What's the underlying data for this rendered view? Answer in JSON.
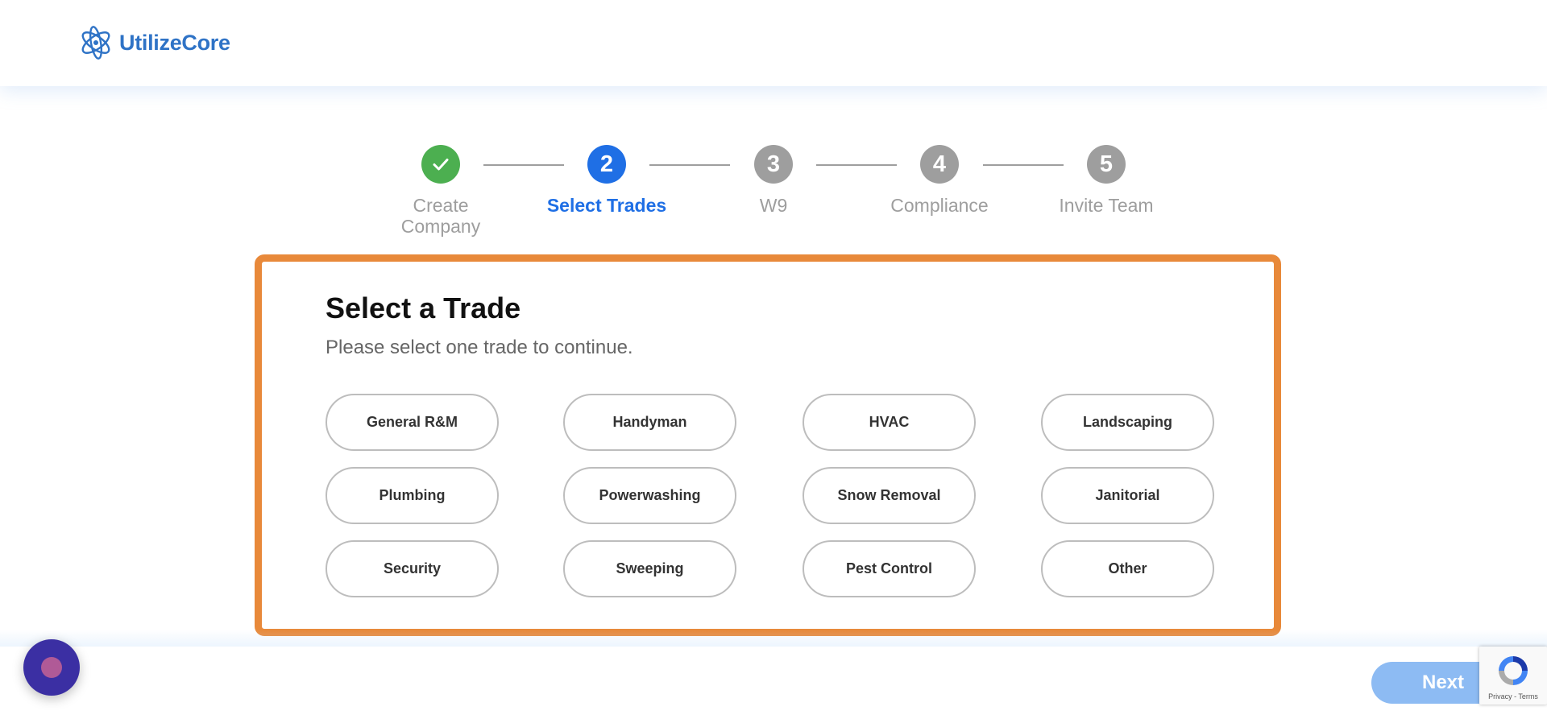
{
  "header": {
    "logo_text": "UtilizeCore"
  },
  "stepper": {
    "steps": [
      {
        "number": "1",
        "label_line1": "Create",
        "label_line2": "Company",
        "state": "completed"
      },
      {
        "number": "2",
        "label_line1": "Select Trades",
        "label_line2": "",
        "state": "active"
      },
      {
        "number": "3",
        "label_line1": "W9",
        "label_line2": "",
        "state": "pending"
      },
      {
        "number": "4",
        "label_line1": "Compliance",
        "label_line2": "",
        "state": "pending"
      },
      {
        "number": "5",
        "label_line1": "Invite Team",
        "label_line2": "",
        "state": "pending"
      }
    ]
  },
  "main": {
    "title": "Select a Trade",
    "subtitle": "Please select one trade to continue.",
    "trades": [
      "General R&M",
      "Handyman",
      "HVAC",
      "Landscaping",
      "Plumbing",
      "Powerwashing",
      "Snow Removal",
      "Janitorial",
      "Security",
      "Sweeping",
      "Pest Control",
      "Other"
    ]
  },
  "footer": {
    "next_label": "Next",
    "recaptcha_links": "Privacy - Terms"
  },
  "colors": {
    "brand": "#2f73c6",
    "active_step": "#1f6fe5",
    "completed_step": "#4caf50",
    "pending_step": "#9e9e9e",
    "card_border": "#e8893a",
    "next_button": "#8dbbf3",
    "chat_bubble": "#3b2fa3"
  },
  "icons": {
    "logo": "atom-orbit-icon",
    "completed_step": "checkmark-icon",
    "chat": "chat-bubble-icon",
    "recaptcha": "recaptcha-icon"
  }
}
